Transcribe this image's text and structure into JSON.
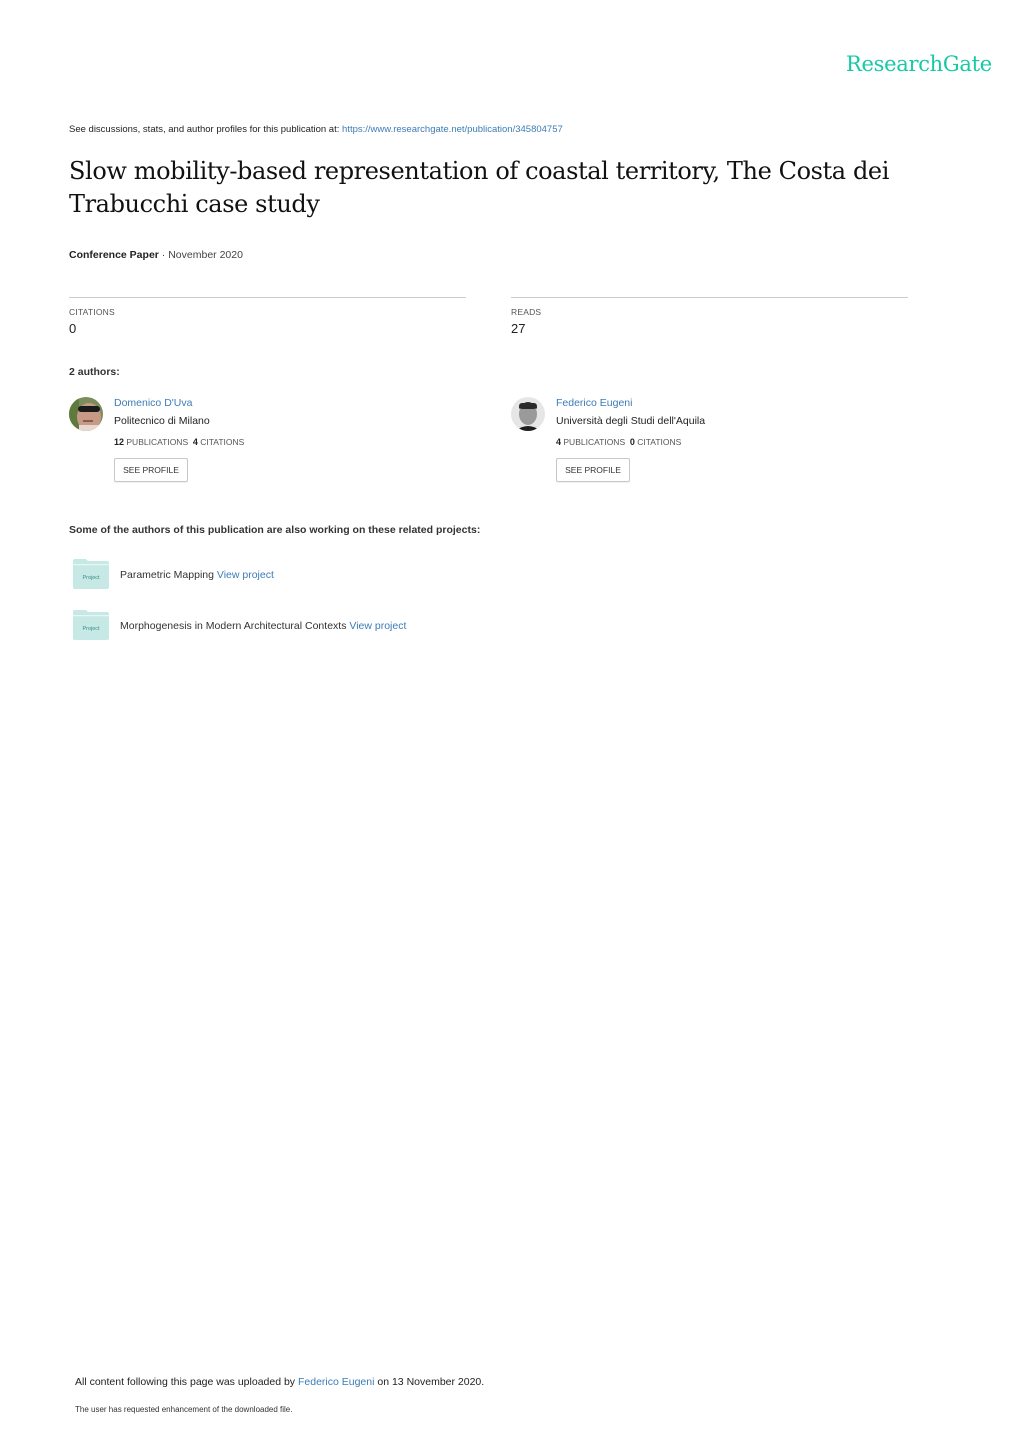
{
  "header": {
    "brand": "ResearchGate",
    "brand_color": "#16c9a6",
    "intro_text": "See discussions, stats, and author profiles for this publication at: ",
    "publication_url": "https://www.researchgate.net/publication/345804757"
  },
  "publication": {
    "title": "Slow mobility-based representation of coastal territory, The Costa dei Trabucchi case study",
    "type": "Conference Paper",
    "separator": " · ",
    "date": "November 2020"
  },
  "stats": {
    "citations_label": "CITATIONS",
    "citations_value": "0",
    "reads_label": "READS",
    "reads_value": "27"
  },
  "authors": {
    "heading": "2 authors:",
    "list": [
      {
        "name": "Domenico D'Uva",
        "institution": "Politecnico di Milano",
        "publications_count": "12",
        "publications_label": "PUBLICATIONS",
        "citations_count": "4",
        "citations_label": "CITATIONS",
        "button_label": "SEE PROFILE"
      },
      {
        "name": "Federico Eugeni",
        "institution": "Università degli Studi dell'Aquila",
        "publications_count": "4",
        "publications_label": "PUBLICATIONS",
        "citations_count": "0",
        "citations_label": "CITATIONS",
        "button_label": "SEE PROFILE"
      }
    ]
  },
  "projects": {
    "heading": "Some of the authors of this publication are also working on these related projects:",
    "icon_label": "Project",
    "items": [
      {
        "name": "Parametric Mapping",
        "link_label": "View project"
      },
      {
        "name": "Morphogenesis in Modern Architectural Contexts",
        "link_label": "View project"
      }
    ]
  },
  "footer": {
    "upload_prefix": "All content following this page was uploaded by ",
    "uploader": "Federico Eugeni",
    "upload_suffix": " on 13 November 2020.",
    "note": "The user has requested enhancement of the downloaded file."
  },
  "colors": {
    "link": "#3c7cb6",
    "folder": "#c7e9e6"
  }
}
